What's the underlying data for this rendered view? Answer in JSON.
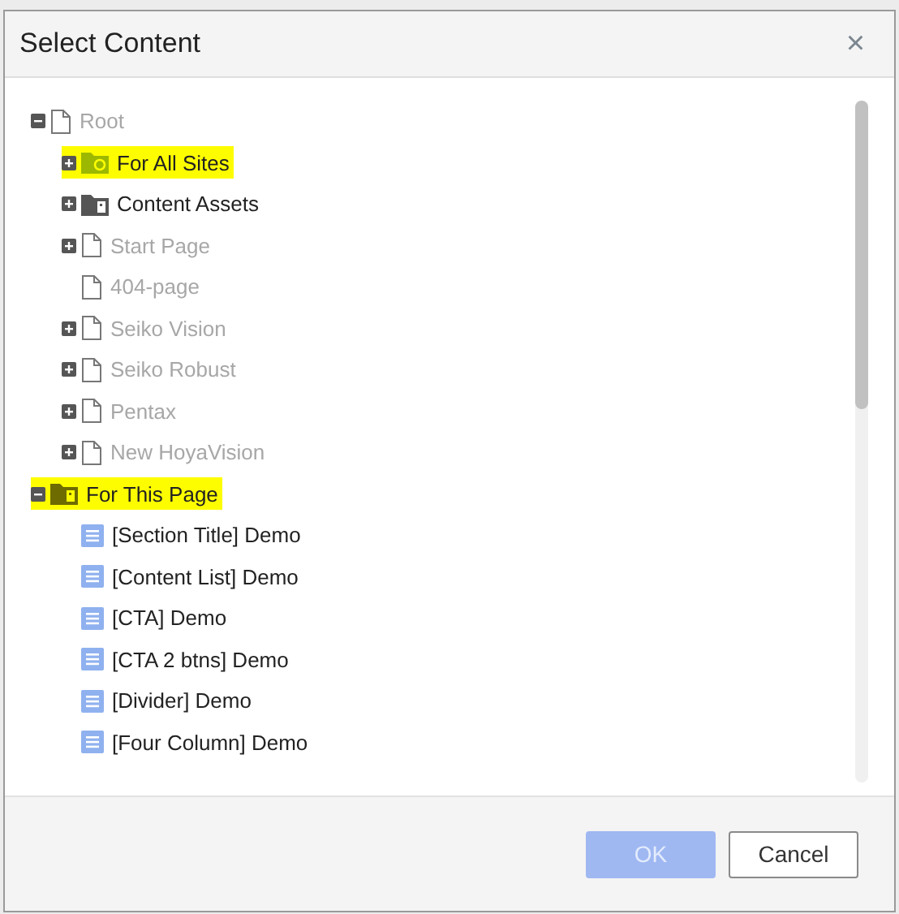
{
  "dialog": {
    "title": "Select Content",
    "close": "×"
  },
  "tree": [
    {
      "label": "Root",
      "kind": "page",
      "expanded": true,
      "disabled": true,
      "highlighted": false,
      "children": [
        {
          "label": "For All Sites",
          "kind": "shared-folder",
          "expanded": false,
          "disabled": false,
          "highlighted": true
        },
        {
          "label": "Content Assets",
          "kind": "folder",
          "expanded": false,
          "disabled": false,
          "highlighted": false
        },
        {
          "label": "Start Page",
          "kind": "page",
          "expanded": false,
          "disabled": true,
          "highlighted": false
        },
        {
          "label": "404-page",
          "kind": "page",
          "disabled": true,
          "highlighted": false
        },
        {
          "label": "Seiko Vision",
          "kind": "page",
          "expanded": false,
          "disabled": true,
          "highlighted": false
        },
        {
          "label": "Seiko Robust",
          "kind": "page",
          "expanded": false,
          "disabled": true,
          "highlighted": false
        },
        {
          "label": "Pentax",
          "kind": "page",
          "expanded": false,
          "disabled": true,
          "highlighted": false
        },
        {
          "label": "New HoyaVision",
          "kind": "page",
          "expanded": false,
          "disabled": true,
          "highlighted": false
        }
      ]
    },
    {
      "label": "For This Page",
      "kind": "folder",
      "expanded": true,
      "disabled": false,
      "highlighted": true,
      "children": [
        {
          "label": "[Section Title] Demo",
          "kind": "block",
          "disabled": false,
          "highlighted": false
        },
        {
          "label": "[Content List] Demo",
          "kind": "block",
          "disabled": false,
          "highlighted": false
        },
        {
          "label": "[CTA] Demo",
          "kind": "block",
          "disabled": false,
          "highlighted": false
        },
        {
          "label": "[CTA 2 btns] Demo",
          "kind": "block",
          "disabled": false,
          "highlighted": false
        },
        {
          "label": "[Divider] Demo",
          "kind": "block",
          "disabled": false,
          "highlighted": false
        },
        {
          "label": "[Four Column] Demo",
          "kind": "block",
          "disabled": false,
          "highlighted": false
        }
      ]
    }
  ],
  "buttons": [
    {
      "label": "OK",
      "kind": "primary",
      "disabled": true
    },
    {
      "label": "Cancel",
      "kind": "secondary",
      "disabled": false
    }
  ]
}
